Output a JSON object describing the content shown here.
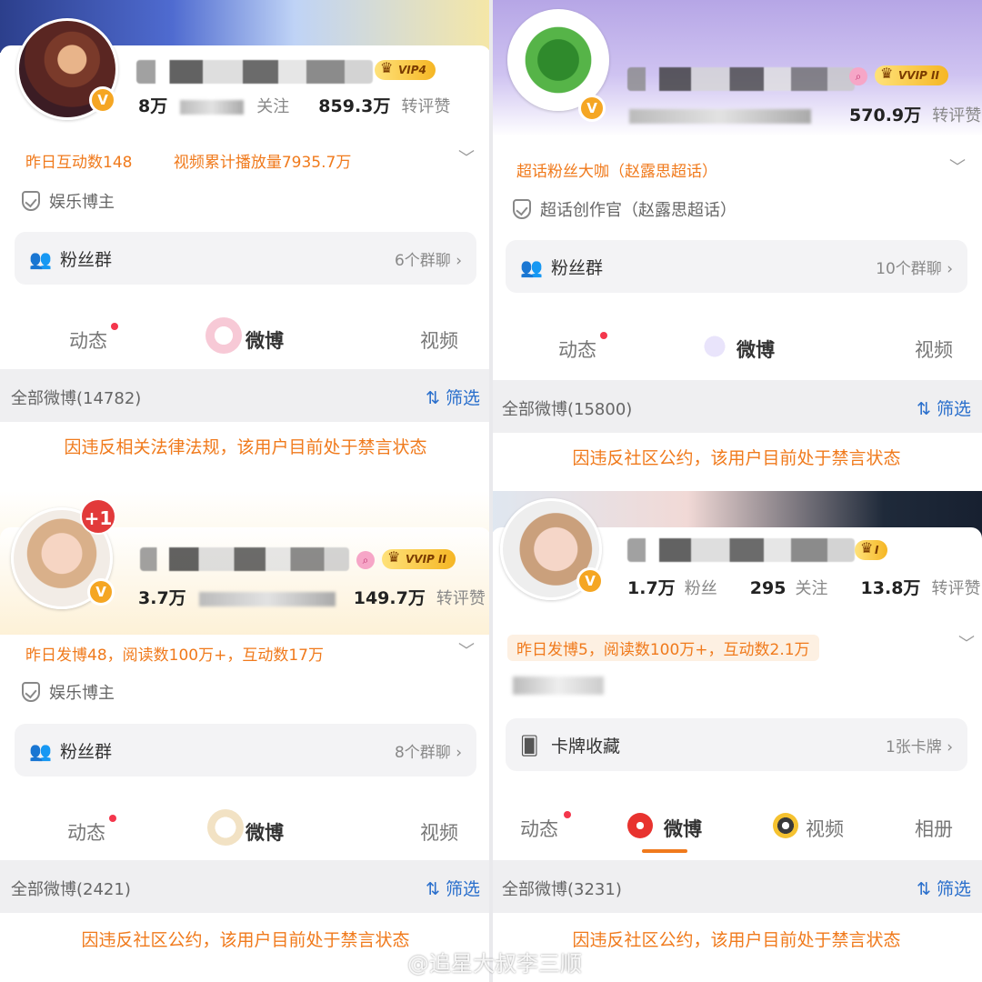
{
  "panels": [
    {
      "vip_level": "VIP4",
      "stats": {
        "followers_partial": "8万",
        "following_label": "关注",
        "reposts": "859.3万",
        "reposts_label": "转评赞"
      },
      "info": "昨日互动数148",
      "info2": "视频累计播放量7935.7万",
      "tagline": "娱乐博主",
      "group_label": "粉丝群",
      "group_count": "6个群聊 ›",
      "tabs": [
        "动态",
        "微博",
        "视频"
      ],
      "weibo_count": "全部微博(14782)",
      "filter_label": "筛选",
      "banned_text": "因违反相关法律法规，该用户目前处于禁言状态"
    },
    {
      "vip_level": "VVIP II",
      "stats": {
        "reposts": "570.9万",
        "reposts_label": "转评赞"
      },
      "info": "超话粉丝大咖（赵露思超话）",
      "tagline": "超话创作官（赵露思超话）",
      "group_label": "粉丝群",
      "group_count": "10个群聊 ›",
      "tabs": [
        "动态",
        "微博",
        "视频"
      ],
      "weibo_count": "全部微博(15800)",
      "filter_label": "筛选",
      "banned_text": "因违反社区公约，该用户目前处于禁言状态"
    },
    {
      "plus_badge": "+1",
      "vip_level": "VVIP II",
      "stats": {
        "followers_partial": "3.7万",
        "reposts": "149.7万",
        "reposts_label": "转评赞"
      },
      "info": "昨日发博48，阅读数100万+，互动数17万",
      "tagline": "娱乐博主",
      "group_label": "粉丝群",
      "group_count": "8个群聊 ›",
      "tabs": [
        "动态",
        "微博",
        "视频"
      ],
      "weibo_count": "全部微博(2421)",
      "filter_label": "筛选",
      "banned_text": "因违反社区公约，该用户目前处于禁言状态"
    },
    {
      "vip_level": "I",
      "stats": {
        "followers": "1.7万",
        "followers_label": "粉丝",
        "following": "295",
        "following_label": "关注",
        "reposts": "13.8万",
        "reposts_label": "转评赞"
      },
      "info": "昨日发博5，阅读数100万+，互动数2.1万",
      "group_label": "卡牌收藏",
      "group_count": "1张卡牌 ›",
      "tabs": [
        "动态",
        "微博",
        "视频",
        "相册"
      ],
      "weibo_count": "全部微博(3231)",
      "filter_label": "筛选",
      "banned_text": "因违反社区公约，该用户目前处于禁言状态"
    }
  ],
  "watermark": "@追星大叔李三顺",
  "colors": {
    "accent": "#f07a1c",
    "link": "#2a6fcc",
    "vip_gold": "#f5b624",
    "red_dot": "#f4364c"
  }
}
